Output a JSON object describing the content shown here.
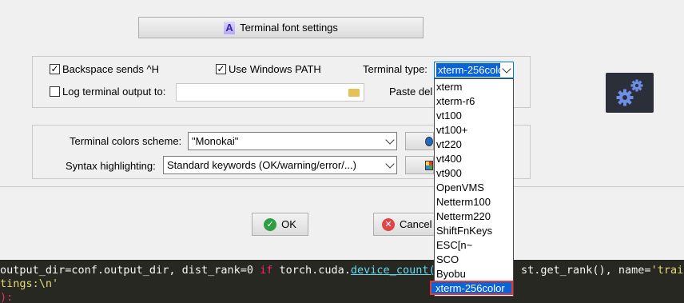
{
  "font_settings_button": {
    "label": "Terminal font settings",
    "icon": "font-a-icon"
  },
  "options": {
    "backspace": {
      "label": "Backspace sends ^H",
      "checked": true
    },
    "windows_path": {
      "label": "Use Windows PATH",
      "checked": true
    },
    "terminal_type_label": "Terminal type:",
    "terminal_type_value": "xterm-256color",
    "log_output": {
      "label": "Log terminal output to:",
      "checked": false
    },
    "log_path": "",
    "paste_label": "Paste del"
  },
  "colors": {
    "scheme_label": "Terminal colors scheme:",
    "scheme_value": "\"Monokai\"",
    "syntax_label": "Syntax highlighting:",
    "syntax_value": "Standard keywords (OK/warning/error/...)"
  },
  "dropdown": {
    "options": [
      "xterm",
      "xterm-r6",
      "vt100",
      "vt100+",
      "vt220",
      "vt400",
      "vt900",
      "OpenVMS",
      "Netterm100",
      "Netterm220",
      "ShiftFnKeys",
      "ESC[n~",
      "SCO",
      "Byobu",
      "xterm-256color"
    ],
    "selected": "xterm-256color",
    "highlight_color": "#e53935",
    "selection_color": "#0a64d6"
  },
  "dialog_buttons": {
    "ok": "OK",
    "cancel": "Cancel"
  },
  "terminal": {
    "line1_a": "output_dir=conf.output_dir, dist_rank=0 ",
    "line1_if": "if",
    "line1_b": " torch.cuda.",
    "line1_fn": "device_count()",
    "line1_c": "st.get_rank(), name=",
    "line1_str": "'train",
    "line2": "tings:\\n'",
    "line3": "):"
  }
}
